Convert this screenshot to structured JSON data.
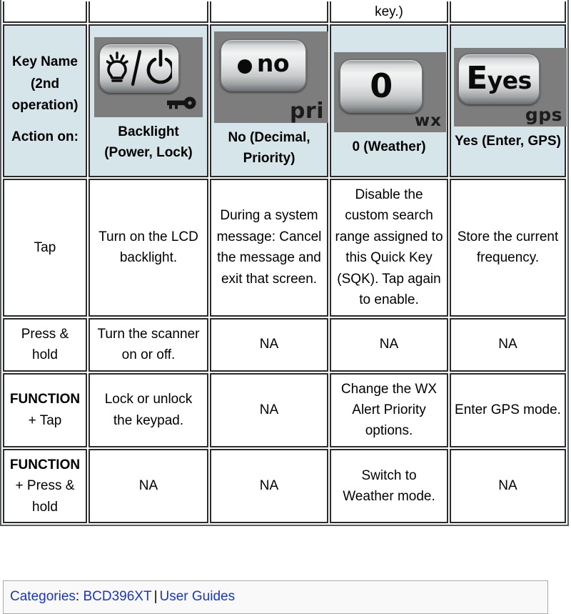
{
  "table": {
    "columns": [
      "key-name",
      "backlight",
      "no-decimal",
      "zero-weather",
      "yes-enter"
    ],
    "clipped_top_row": {
      "cells": [
        "",
        "",
        "",
        "key.)",
        ""
      ]
    },
    "header_row": {
      "label_line1": "Key Name (2nd operation)",
      "label_line2": "Action on:",
      "keys": [
        {
          "id": "backlight",
          "cap_glyph": "lightbulb-slash-power-icon",
          "second_function_glyph": "lock-key-icon",
          "caption": "Backlight (Power, Lock)"
        },
        {
          "id": "no-decimal",
          "cap_text": "no",
          "cap_mark": "dot",
          "second_function_label": "pri",
          "caption": "No (Decimal, Priority)"
        },
        {
          "id": "zero-weather",
          "cap_text": "0",
          "second_function_label": "wx",
          "caption": "0 (Weather)"
        },
        {
          "id": "yes-enter",
          "cap_text_prefix": "E",
          "cap_text_suffix": "yes",
          "second_function_label": "gps",
          "caption": "Yes (Enter, GPS)"
        }
      ]
    },
    "rows": [
      {
        "action": "Tap",
        "action_bold_prefix": "",
        "cells": [
          "Turn on the LCD backlight.",
          "During a system message: Cancel the message and exit that screen.",
          "Disable the custom search range assigned to this Quick Key (SQK). Tap again to enable.",
          "Store the current frequency."
        ]
      },
      {
        "action": "Press & hold",
        "action_bold_prefix": "",
        "cells": [
          "Turn the scanner on or off.",
          "NA",
          "NA",
          "NA"
        ]
      },
      {
        "action_bold_prefix": "FUNCTION",
        "action": " + Tap",
        "cells": [
          "Lock or unlock the keypad.",
          "NA",
          "Change the WX Alert Priority options.",
          "Enter GPS mode."
        ]
      },
      {
        "action_bold_prefix": "FUNCTION",
        "action": " + Press & hold",
        "cells": [
          "NA",
          "NA",
          "Switch to Weather mode.",
          "NA"
        ]
      }
    ]
  },
  "catlinks": {
    "categories_label": "Categories",
    "colon": ":",
    "links": [
      "BCD396XT",
      "User Guides"
    ],
    "separator": "|"
  },
  "colors": {
    "header_bg": "#d5e5ea",
    "key_plate_bg": "#7d7d7d",
    "link_blue": "#1b35c4",
    "catlinks_bg": "#f9f9f9",
    "border": "#2b2b2b"
  }
}
